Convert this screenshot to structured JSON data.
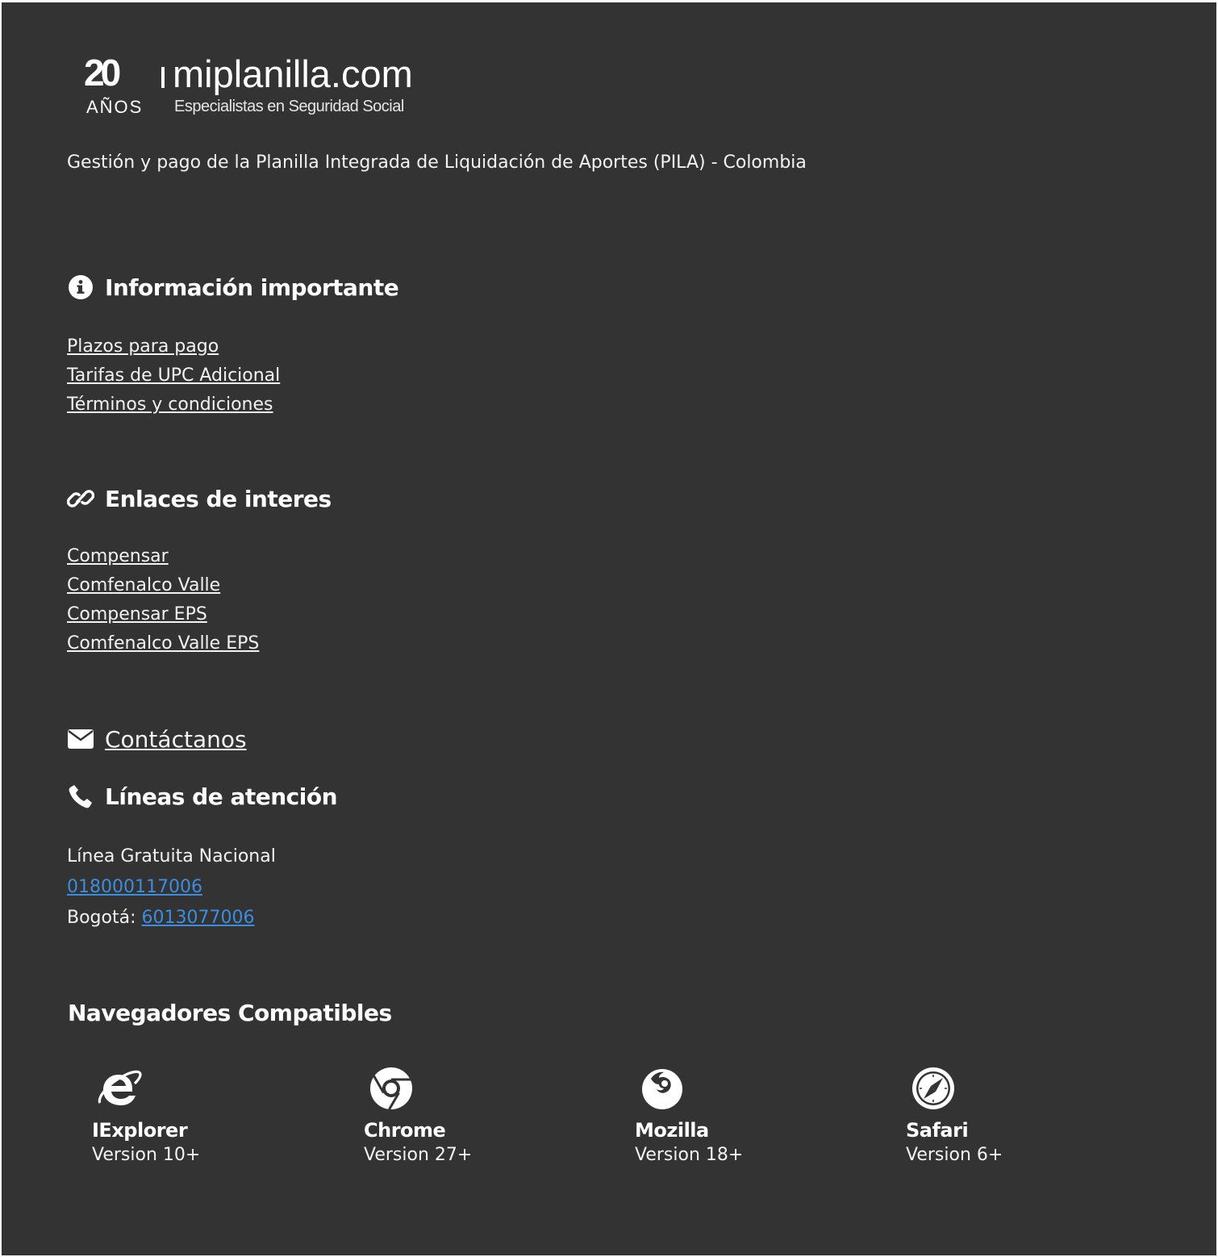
{
  "logo": {
    "years": "20",
    "years_label": "AÑOS",
    "brand": "miplanilla.com",
    "slogan": "Especialistas en Seguridad Social"
  },
  "tagline": "Gestión y pago de la Planilla Integrada de Liquidación de Aportes (PILA) - Colombia",
  "info": {
    "title": "Información importante",
    "icon": "info-circle-icon",
    "links": [
      "Plazos para pago",
      "Tarifas de UPC Adicional",
      "Términos y condiciones"
    ]
  },
  "interest": {
    "title": "Enlaces de interes",
    "icon": "link-icon",
    "links": [
      "Compensar",
      "Comfenalco Valle",
      "Compensar EPS",
      "Comfenalco Valle EPS"
    ]
  },
  "contact": {
    "label": "Contáctanos",
    "icon": "envelope-icon"
  },
  "support": {
    "title": "Líneas de atención",
    "icon": "phone-icon",
    "national_label": "Línea Gratuita Nacional",
    "national_number": "018000117006",
    "bogota_label": "Bogotá:",
    "bogota_number": "6013077006",
    "link_color": "#3d8ddf"
  },
  "browsers": {
    "title": "Navegadores Compatibles",
    "items": [
      {
        "name": "IExplorer",
        "version": "Version 10+",
        "icon": "internet-explorer-icon"
      },
      {
        "name": "Chrome",
        "version": "Version 27+",
        "icon": "chrome-icon"
      },
      {
        "name": "Mozilla",
        "version": "Version 18+",
        "icon": "firefox-icon"
      },
      {
        "name": "Safari",
        "version": "Version 6+",
        "icon": "safari-icon"
      }
    ]
  },
  "colors": {
    "background": "#333333",
    "text": "#ffffff",
    "link": "#3d8ddf"
  }
}
